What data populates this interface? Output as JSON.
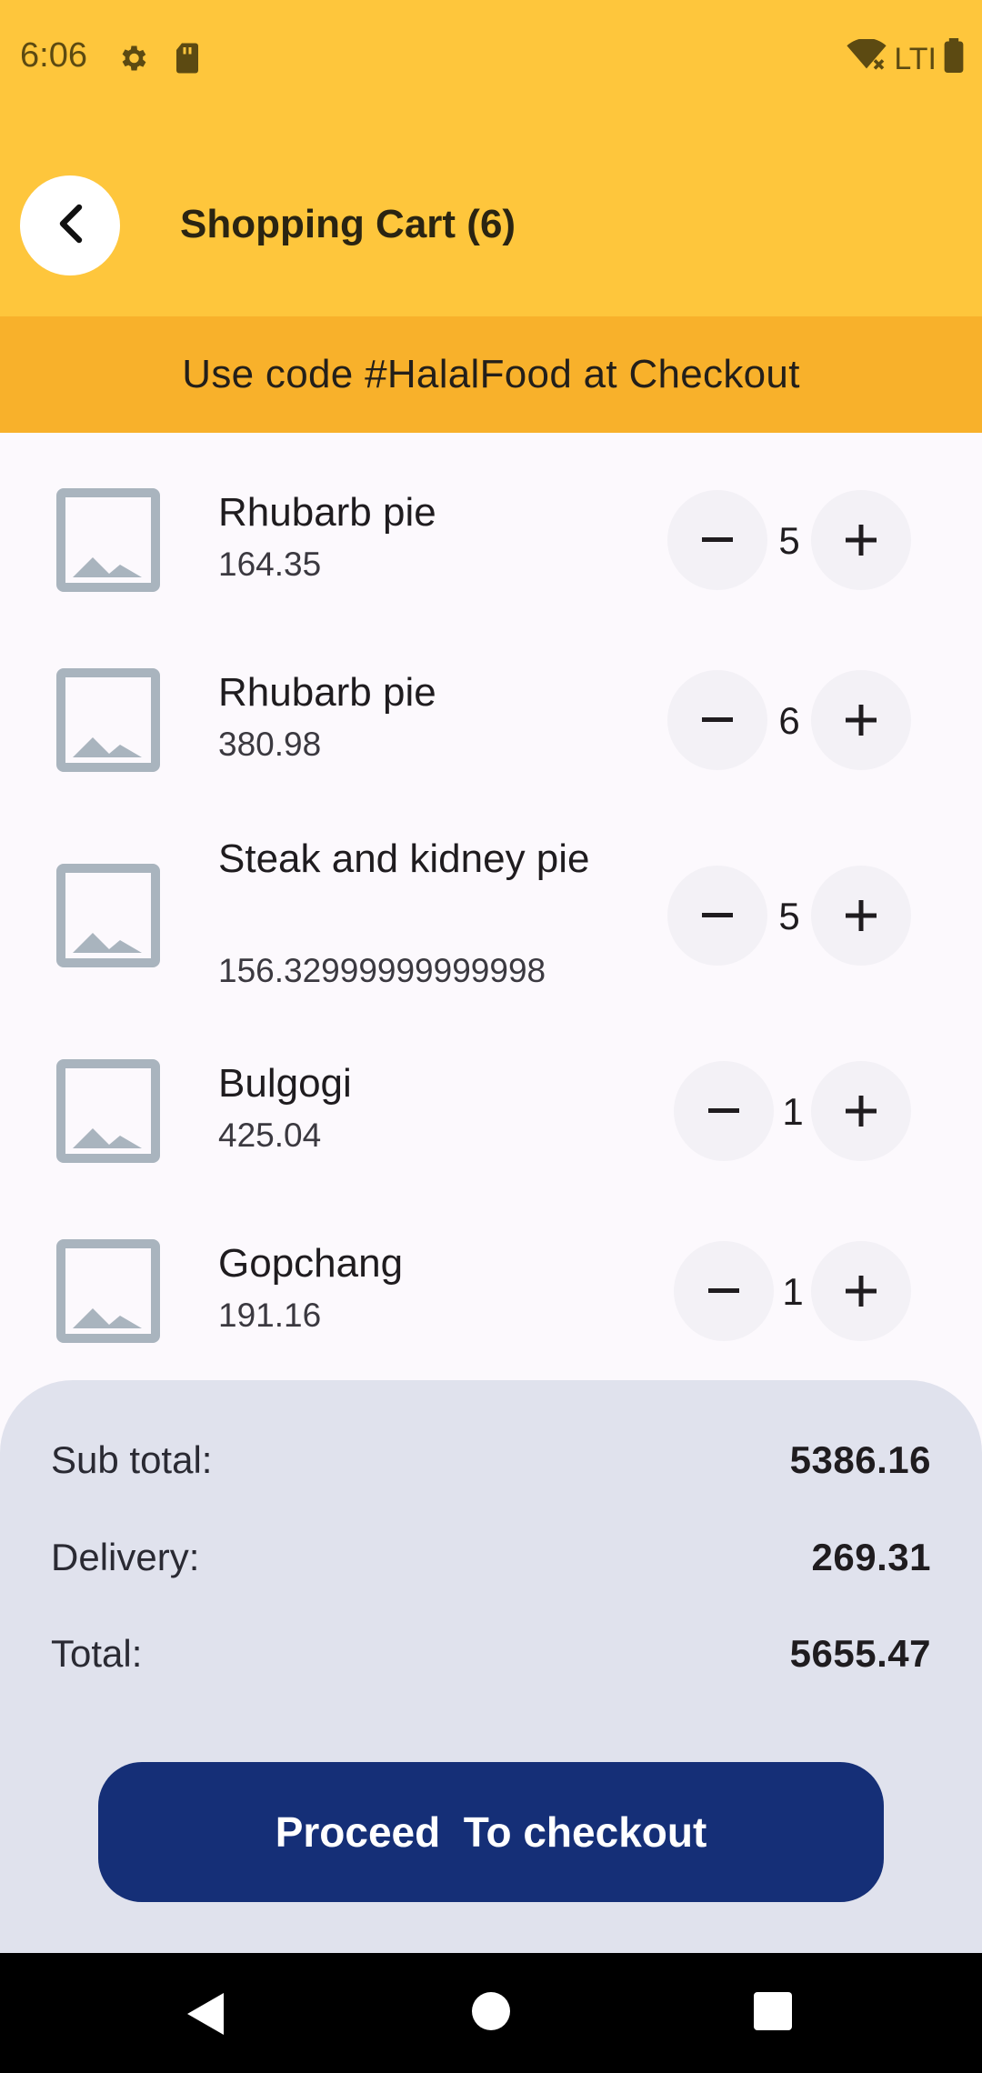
{
  "status_bar": {
    "time": "6:06",
    "network": "LTI"
  },
  "header": {
    "title": "Shopping Cart (6)"
  },
  "promo": {
    "text": "Use code #HalalFood at Checkout"
  },
  "cart": {
    "items": [
      {
        "name": "Rhubarb pie",
        "price": "164.35",
        "qty": "5"
      },
      {
        "name": "Rhubarb pie",
        "price": "380.98",
        "qty": "6"
      },
      {
        "name": "Steak and kidney pie",
        "price": "156.32999999999998",
        "qty": "5"
      },
      {
        "name": "Bulgogi",
        "price": "425.04",
        "qty": "1"
      },
      {
        "name": "Gopchang",
        "price": "191.16",
        "qty": "1"
      }
    ]
  },
  "summary": {
    "subtotal_label": "Sub total:",
    "subtotal_value": "5386.16",
    "delivery_label": "Delivery:",
    "delivery_value": "269.31",
    "total_label": "Total:",
    "total_value": "5655.47",
    "checkout_label": "Proceed  To checkout"
  },
  "colors": {
    "header_bg": "#FEC63C",
    "promo_bg": "#F8B12B",
    "summary_bg": "#E0E2ED",
    "checkout_bg": "#152F77"
  },
  "icons": [
    "gear-icon",
    "sd-card-icon",
    "wifi-icon",
    "battery-icon",
    "back-arrow-icon",
    "image-placeholder-icon",
    "minus-icon",
    "plus-icon",
    "nav-back-icon",
    "nav-home-icon",
    "nav-recents-icon"
  ]
}
